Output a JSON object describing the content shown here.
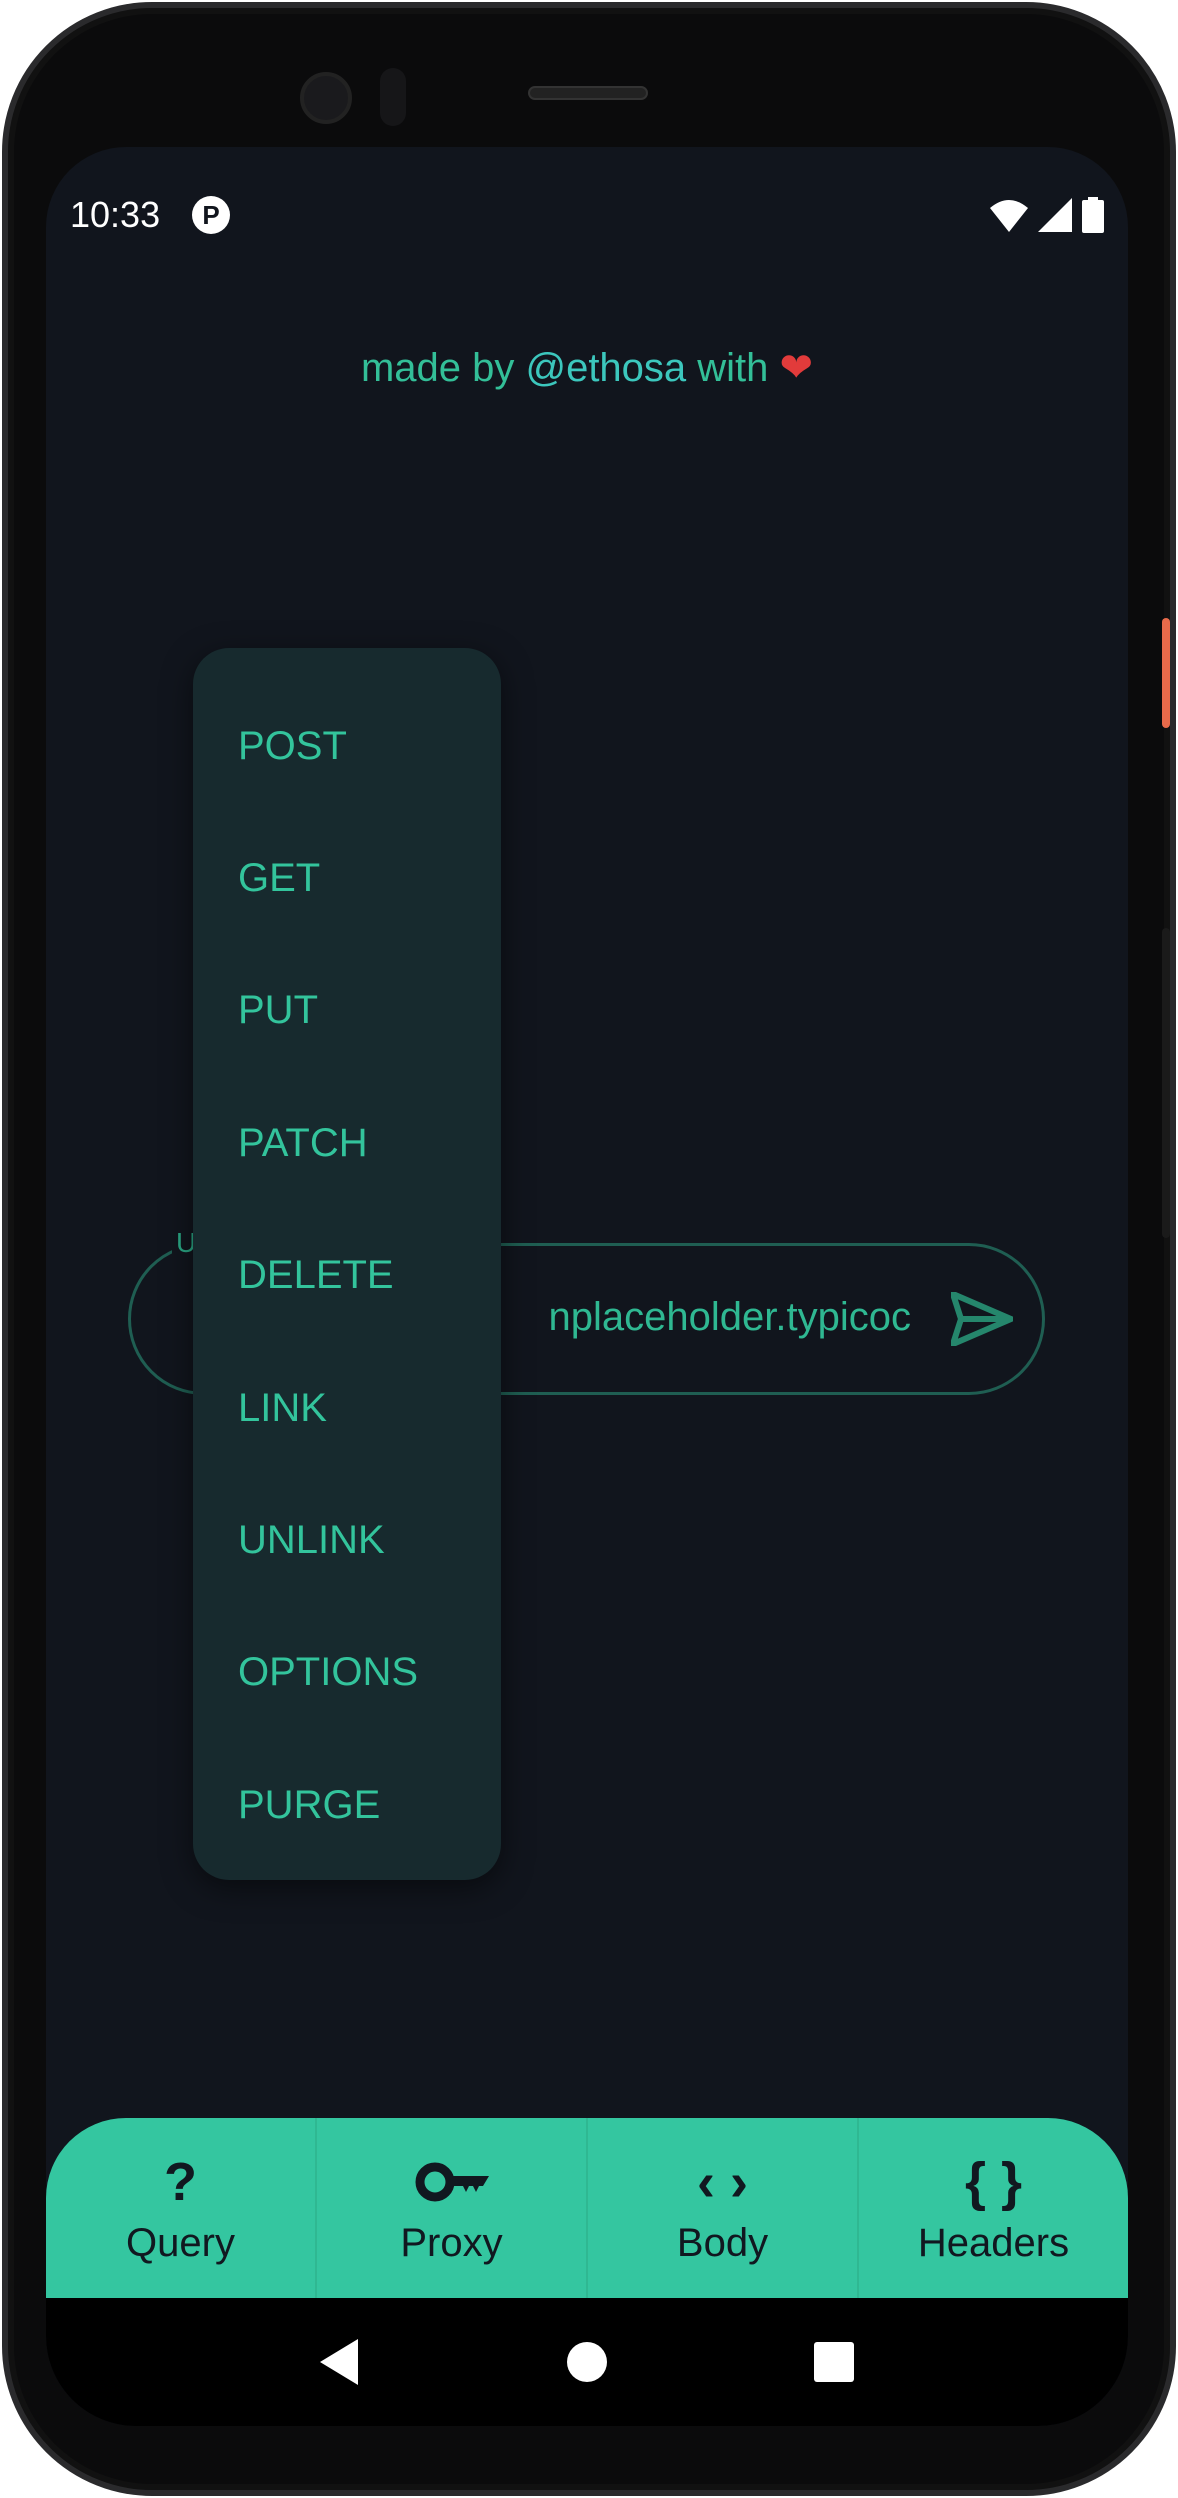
{
  "status_bar": {
    "time": "10:33",
    "app_icon": "pi-icon",
    "icons": [
      "wifi-icon",
      "signal-icon",
      "battery-icon"
    ]
  },
  "credit": {
    "prefix": "made by ",
    "handle": "@ethosa",
    "suffix": " with ",
    "heart": "❤"
  },
  "url_field": {
    "label": "U",
    "value": "jsonplaceholder.typicode.com",
    "visible_value": "nplaceholder.typicoc"
  },
  "method_menu": {
    "items": [
      "POST",
      "GET",
      "PUT",
      "PATCH",
      "DELETE",
      "LINK",
      "UNLINK",
      "OPTIONS",
      "PURGE"
    ]
  },
  "bottom_nav": {
    "tabs": [
      {
        "label": "Query",
        "icon": "question-icon",
        "glyph": "?"
      },
      {
        "label": "Proxy",
        "icon": "key-icon"
      },
      {
        "label": "Body",
        "icon": "code-icon",
        "glyph": "‹ ›"
      },
      {
        "label": "Headers",
        "icon": "braces-icon",
        "glyph": "{ }"
      }
    ]
  },
  "colors": {
    "accent": "#34c6a0",
    "background": "#11151d",
    "menu": "#172a2e"
  }
}
